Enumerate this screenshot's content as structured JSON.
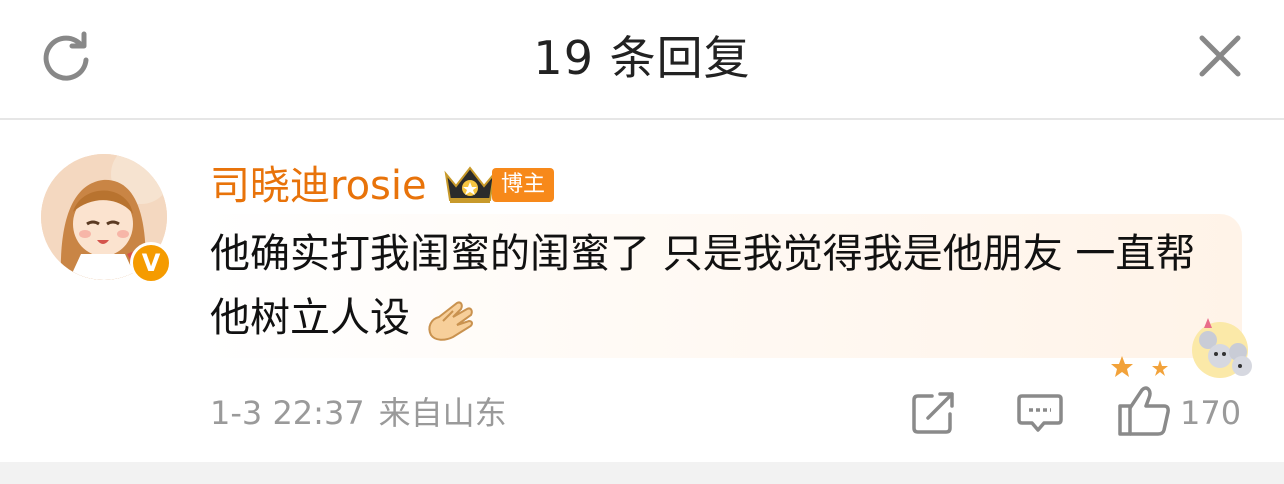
{
  "header": {
    "title": "19 条回复",
    "refresh_icon": "refresh-icon",
    "close_icon": "close-icon"
  },
  "comment": {
    "username": "司晓迪rosie",
    "role_badge": "博主",
    "verified_mark": "V",
    "text": "他确实打我闺蜜的闺蜜了 只是我觉得我是他朋友 一直帮他树立人设",
    "emoji": "clap-hands-emoji",
    "timestamp": "1-3 22:37",
    "location": "来自山东",
    "like_count": "170",
    "icons": {
      "share": "share-icon",
      "comment": "comment-icon",
      "like": "thumbs-up-icon"
    },
    "colors": {
      "username": "#e8730a",
      "badge": "#f7891a",
      "verified": "#f59b00"
    }
  }
}
